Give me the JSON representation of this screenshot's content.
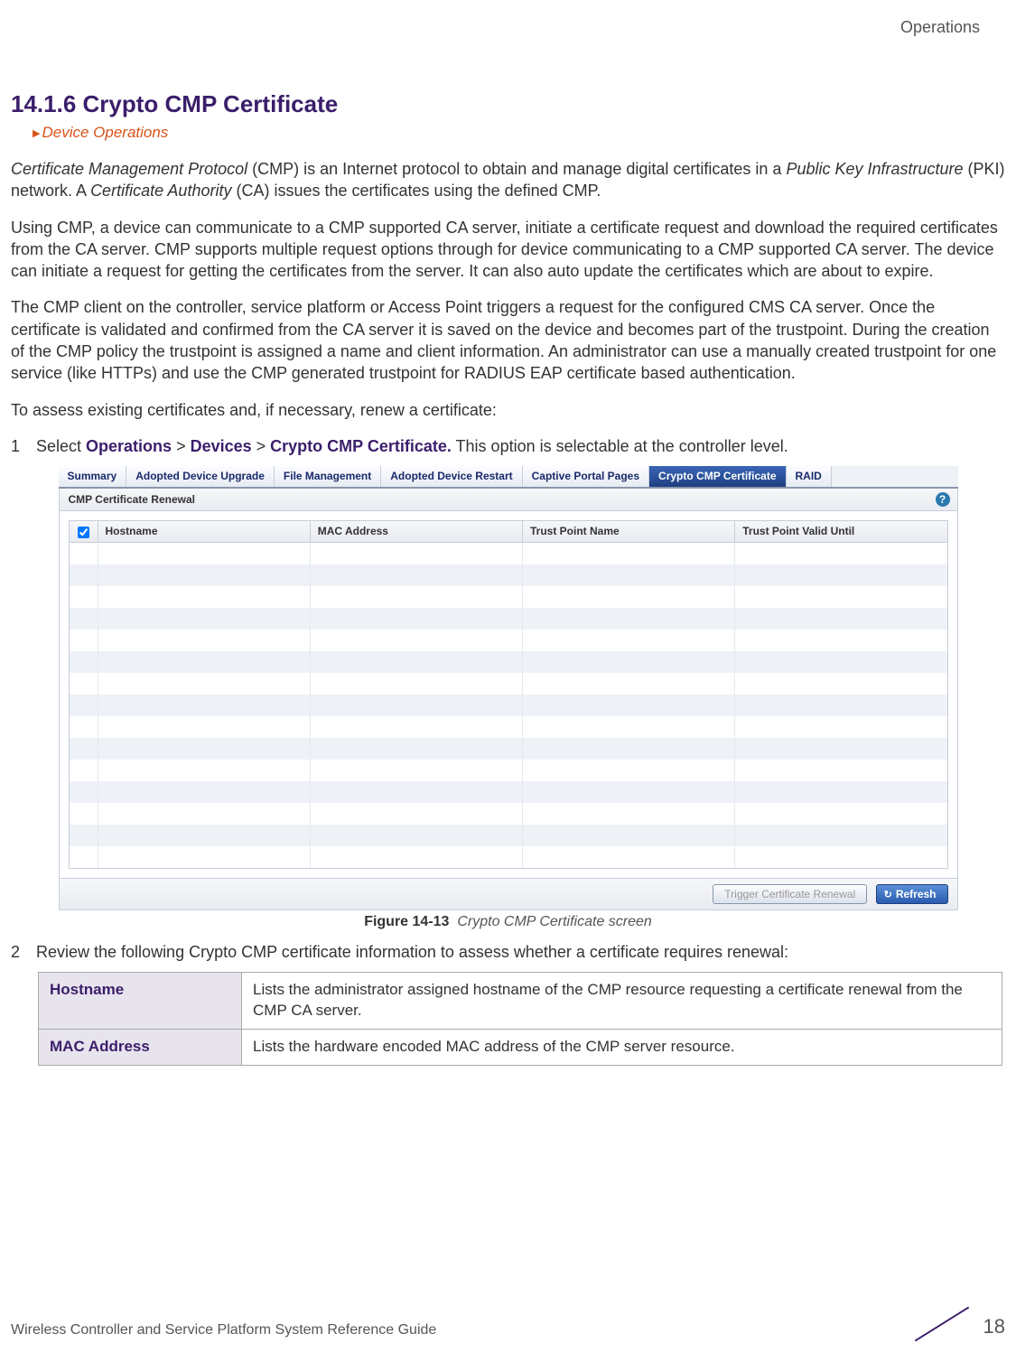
{
  "header": {
    "right": "Operations"
  },
  "section": {
    "number": "14.1.6",
    "title": "Crypto CMP Certificate",
    "breadcrumb": "Device Operations"
  },
  "paragraphs": {
    "p1_a": "Certificate Management Protocol",
    "p1_b": " (CMP) is an Internet protocol to obtain and manage digital certificates in a ",
    "p1_c": "Public Key Infrastructure",
    "p1_d": " (PKI) network. A ",
    "p1_e": "Certificate Authority",
    "p1_f": " (CA) issues the certificates using the defined CMP.",
    "p2": "Using CMP, a device can communicate to a CMP supported CA server, initiate a certificate request and download the required certificates from the CA server. CMP supports multiple request options through for device communicating to a CMP supported CA server. The device can initiate a request for getting the certificates from the server. It can also auto update the certificates which are about to expire.",
    "p3": "The CMP client on the controller, service platform or Access Point triggers a request for the configured CMS CA server. Once the certificate is validated and confirmed from the CA server it is saved on the device and becomes part of the trustpoint. During the creation of the CMP policy the trustpoint is assigned a name and client information. An administrator can use a manually created trustpoint for one service (like HTTPs) and use the CMP generated trustpoint for RADIUS EAP certificate based authentication.",
    "p4": "To assess existing certificates and, if necessary, renew a certificate:"
  },
  "steps": {
    "s1_num": "1",
    "s1_a": "Select ",
    "s1_nav1": "Operations",
    "s1_sep": " > ",
    "s1_nav2": "Devices",
    "s1_nav3": "Crypto CMP Certificate.",
    "s1_b": " This option is selectable at the controller level.",
    "s2_num": "2",
    "s2_a": "Review the following Crypto CMP certificate information to assess whether a certificate requires renewal:"
  },
  "ui": {
    "tabs": [
      "Summary",
      "Adopted Device Upgrade",
      "File Management",
      "Adopted Device Restart",
      "Captive Portal Pages",
      "Crypto CMP Certificate",
      "RAID"
    ],
    "activeTabIndex": 5,
    "panelTitle": "CMP Certificate Renewal",
    "columns": [
      "Hostname",
      "MAC Address",
      "Trust Point Name",
      "Trust Point Valid Until"
    ],
    "footerButtons": {
      "trigger": "Trigger Certificate Renewal",
      "refresh": "Refresh"
    }
  },
  "figure": {
    "label": "Figure 14-13",
    "title": "Crypto CMP Certificate screen"
  },
  "descTable": {
    "rows": [
      {
        "key": "Hostname",
        "val": "Lists the administrator assigned hostname of the CMP resource requesting a certificate renewal from the CMP CA server."
      },
      {
        "key": "MAC Address",
        "val": "Lists the hardware encoded MAC address of the CMP server resource."
      }
    ]
  },
  "footer": {
    "guide": "Wireless Controller and Service Platform System Reference Guide",
    "page": "18"
  }
}
